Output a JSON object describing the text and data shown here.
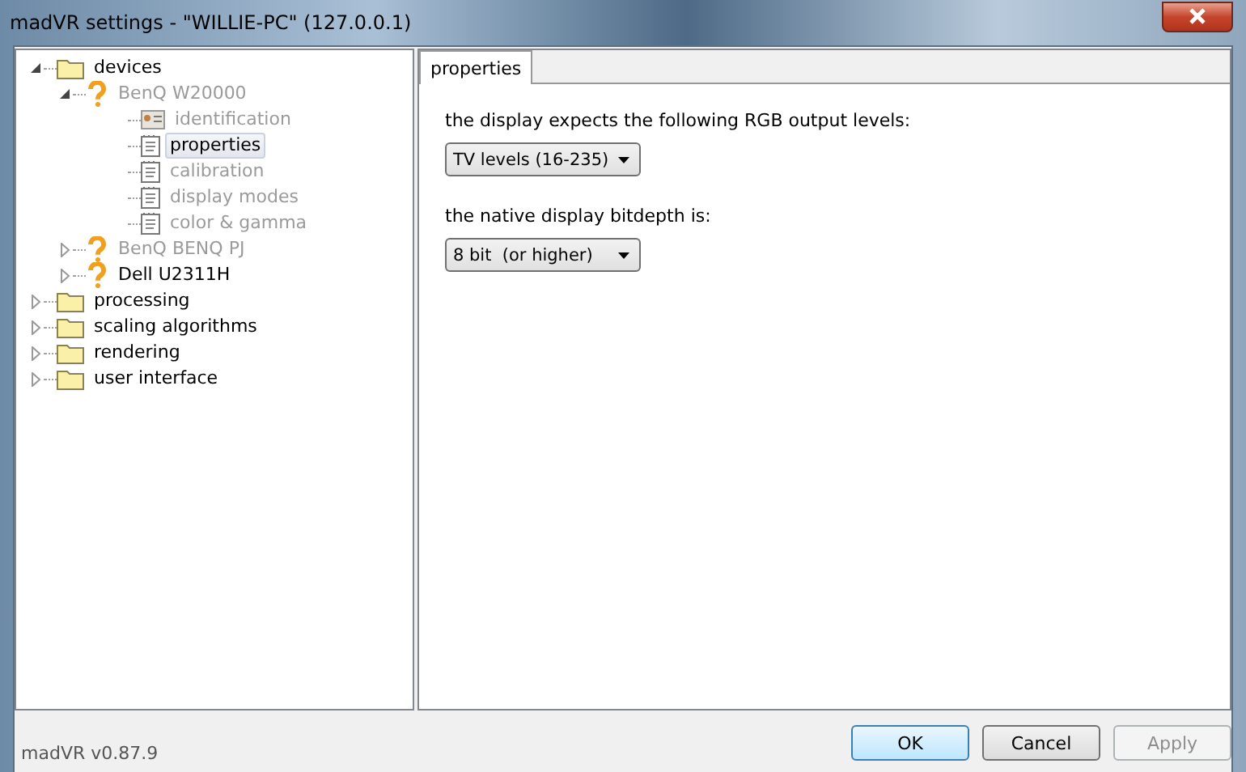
{
  "window": {
    "title": "madVR settings - \"WILLIE-PC\" (127.0.0.1)"
  },
  "tree": [
    {
      "label": "devices",
      "kind": "folder",
      "expanded": true,
      "disabled": false,
      "selected": false,
      "children": [
        {
          "label": "BenQ W20000",
          "kind": "device",
          "expanded": true,
          "disabled": true,
          "selected": false,
          "children": [
            {
              "label": "identification",
              "kind": "id",
              "disabled": true,
              "selected": false
            },
            {
              "label": "properties",
              "kind": "page",
              "disabled": false,
              "selected": true
            },
            {
              "label": "calibration",
              "kind": "page",
              "disabled": true,
              "selected": false
            },
            {
              "label": "display modes",
              "kind": "page",
              "disabled": true,
              "selected": false
            },
            {
              "label": "color & gamma",
              "kind": "page",
              "disabled": true,
              "selected": false
            }
          ]
        },
        {
          "label": "BenQ BENQ PJ",
          "kind": "device",
          "expanded": false,
          "disabled": true,
          "selected": false
        },
        {
          "label": "Dell U2311H",
          "kind": "device",
          "expanded": false,
          "disabled": false,
          "selected": false
        }
      ]
    },
    {
      "label": "processing",
      "kind": "folder",
      "expanded": false,
      "disabled": false,
      "selected": false
    },
    {
      "label": "scaling algorithms",
      "kind": "folder",
      "expanded": false,
      "disabled": false,
      "selected": false
    },
    {
      "label": "rendering",
      "kind": "folder",
      "expanded": false,
      "disabled": false,
      "selected": false
    },
    {
      "label": "user interface",
      "kind": "folder",
      "expanded": false,
      "disabled": false,
      "selected": false
    }
  ],
  "tabs": [
    {
      "label": "properties",
      "selected": true
    }
  ],
  "settings": [
    {
      "label": "the display expects the following RGB output levels:",
      "value": "TV levels (16-235)"
    },
    {
      "label": "the native display bitdepth is:",
      "value": "8 bit  (or higher)"
    }
  ],
  "status": {
    "version": "madVR v0.87.9"
  },
  "buttons": [
    {
      "label": "OK",
      "default": true,
      "disabled": false
    },
    {
      "label": "Cancel",
      "default": false,
      "disabled": false
    },
    {
      "label": "Apply",
      "default": false,
      "disabled": true
    }
  ]
}
